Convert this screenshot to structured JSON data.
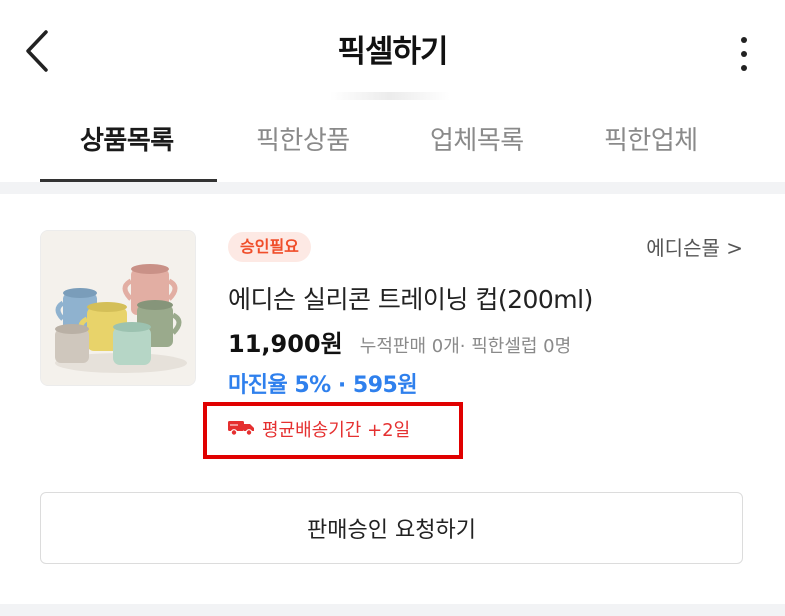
{
  "header": {
    "title": "픽셀하기"
  },
  "tabs": [
    {
      "label": "상품목록",
      "active": true
    },
    {
      "label": "픽한상품",
      "active": false
    },
    {
      "label": "업체목록",
      "active": false
    },
    {
      "label": "픽한업체",
      "active": false
    }
  ],
  "product": {
    "badge": "승인필요",
    "vendor": "에디슨몰 >",
    "name": "에디슨 실리콘 트레이닝 컵(200ml)",
    "price": "11,900원",
    "stats": "누적판매 0개· 픽한셀럽 0명",
    "margin": "마진율 5% · 595원",
    "delivery": "평균배송기간 +2일"
  },
  "actions": {
    "request_label": "판매승인 요청하기"
  },
  "colors": {
    "accent_blue": "#2f80ed",
    "badge_red": "#f04e2a",
    "delivery_red": "#e53030",
    "highlight_border": "#e00000"
  },
  "icons": {
    "back": "chevron-left-icon",
    "more": "more-vertical-icon",
    "delivery": "truck-icon"
  }
}
